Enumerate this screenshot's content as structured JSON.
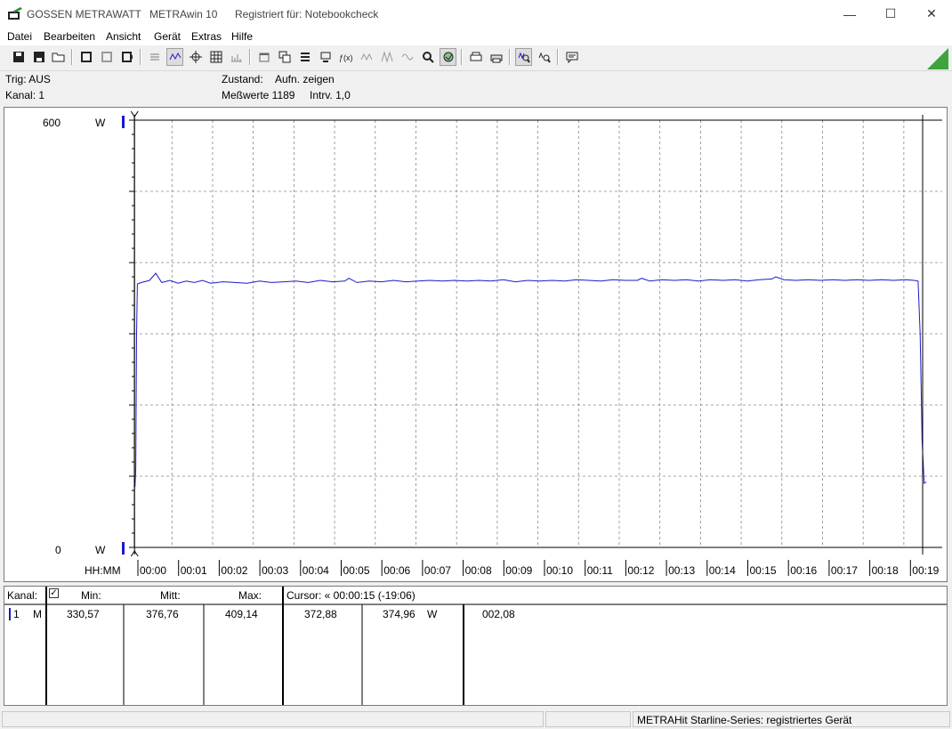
{
  "window": {
    "title_parts": [
      "GOSSEN METRAWATT",
      "METRAwin 10",
      "Registriert für: Notebookcheck"
    ],
    "minimize": "—",
    "maximize": "☐",
    "close": "✕"
  },
  "menu": [
    "Datei",
    "Bearbeiten",
    "Ansicht",
    "Gerät",
    "Extras",
    "Hilfe"
  ],
  "info": {
    "trig": "Trig: AUS",
    "kanal": "Kanal: 1",
    "zustand_label": "Zustand:",
    "zustand_value": "Aufn. zeigen",
    "messwerte": "Meßwerte 1189",
    "intrv": "Intrv. 1,0"
  },
  "chart_data": {
    "type": "line",
    "y_top_label": "600",
    "y_bottom_label": "0",
    "y_unit": "W",
    "ylim": [
      0,
      600
    ],
    "x_axis_label": "HH:MM",
    "x_ticks": [
      "00:00",
      "00:01",
      "00:02",
      "00:03",
      "00:04",
      "00:05",
      "00:06",
      "00:07",
      "00:08",
      "00:09",
      "00:10",
      "00:11",
      "00:12",
      "00:13",
      "00:14",
      "00:15",
      "00:16",
      "00:17",
      "00:18",
      "00:19"
    ],
    "xlim_minutes": [
      -0.17,
      19.3
    ],
    "grid": true,
    "line_color": "#1a1acc",
    "series": [
      {
        "points": [
          [
            -0.16,
            85
          ],
          [
            -0.14,
            110
          ],
          [
            -0.12,
            300
          ],
          [
            -0.1,
            370
          ],
          [
            0.0,
            372
          ],
          [
            0.2,
            375
          ],
          [
            0.35,
            385
          ],
          [
            0.5,
            372
          ],
          [
            0.7,
            375
          ],
          [
            0.9,
            371
          ],
          [
            1.1,
            374
          ],
          [
            1.3,
            372
          ],
          [
            1.5,
            375
          ],
          [
            1.7,
            371
          ],
          [
            2.0,
            373
          ],
          [
            2.3,
            372
          ],
          [
            2.6,
            371
          ],
          [
            2.9,
            374
          ],
          [
            3.2,
            372
          ],
          [
            3.5,
            373
          ],
          [
            3.8,
            374
          ],
          [
            4.1,
            372
          ],
          [
            4.4,
            375
          ],
          [
            4.7,
            373
          ],
          [
            5.0,
            374
          ],
          [
            5.1,
            378
          ],
          [
            5.3,
            372
          ],
          [
            5.6,
            374
          ],
          [
            5.9,
            373
          ],
          [
            6.2,
            375
          ],
          [
            6.5,
            373
          ],
          [
            6.8,
            374
          ],
          [
            7.1,
            375
          ],
          [
            7.4,
            374
          ],
          [
            7.7,
            375
          ],
          [
            8.0,
            374
          ],
          [
            8.3,
            375
          ],
          [
            8.6,
            374
          ],
          [
            8.9,
            376
          ],
          [
            9.2,
            373
          ],
          [
            9.5,
            375
          ],
          [
            9.8,
            374
          ],
          [
            10.1,
            375
          ],
          [
            10.4,
            374
          ],
          [
            10.7,
            376
          ],
          [
            11.0,
            375
          ],
          [
            11.3,
            374
          ],
          [
            11.6,
            376
          ],
          [
            11.9,
            375
          ],
          [
            12.2,
            375
          ],
          [
            12.3,
            378
          ],
          [
            12.5,
            374
          ],
          [
            12.8,
            376
          ],
          [
            13.1,
            375
          ],
          [
            13.4,
            376
          ],
          [
            13.7,
            374
          ],
          [
            14.0,
            376
          ],
          [
            14.3,
            375
          ],
          [
            14.6,
            376
          ],
          [
            14.9,
            374
          ],
          [
            15.2,
            376
          ],
          [
            15.5,
            377
          ],
          [
            15.6,
            380
          ],
          [
            15.8,
            376
          ],
          [
            16.1,
            375
          ],
          [
            16.4,
            376
          ],
          [
            16.7,
            375
          ],
          [
            17.0,
            376
          ],
          [
            17.3,
            375
          ],
          [
            17.6,
            376
          ],
          [
            17.9,
            375
          ],
          [
            18.2,
            376
          ],
          [
            18.5,
            375
          ],
          [
            18.8,
            376
          ],
          [
            19.0,
            375
          ],
          [
            19.1,
            374
          ],
          [
            19.15,
            300
          ],
          [
            19.2,
            150
          ],
          [
            19.25,
            90
          ],
          [
            19.3,
            92
          ]
        ]
      }
    ]
  },
  "table": {
    "kanal_header": "Kanal:",
    "min_header": "Min:",
    "mitt_header": "Mitt:",
    "max_header": "Max:",
    "cursor_header": "Cursor: « 00:00:15 (-19:06)",
    "row": {
      "channel": "1",
      "mode": "M",
      "min": "330,57",
      "mitt": "376,76",
      "max": "409,14",
      "cursor_value1": "372,88",
      "cursor_value2": "374,96",
      "unit": "W",
      "extra": "002,08"
    }
  },
  "statusbar": {
    "device": "METRAHit Starline-Series: registriertes Gerät"
  }
}
